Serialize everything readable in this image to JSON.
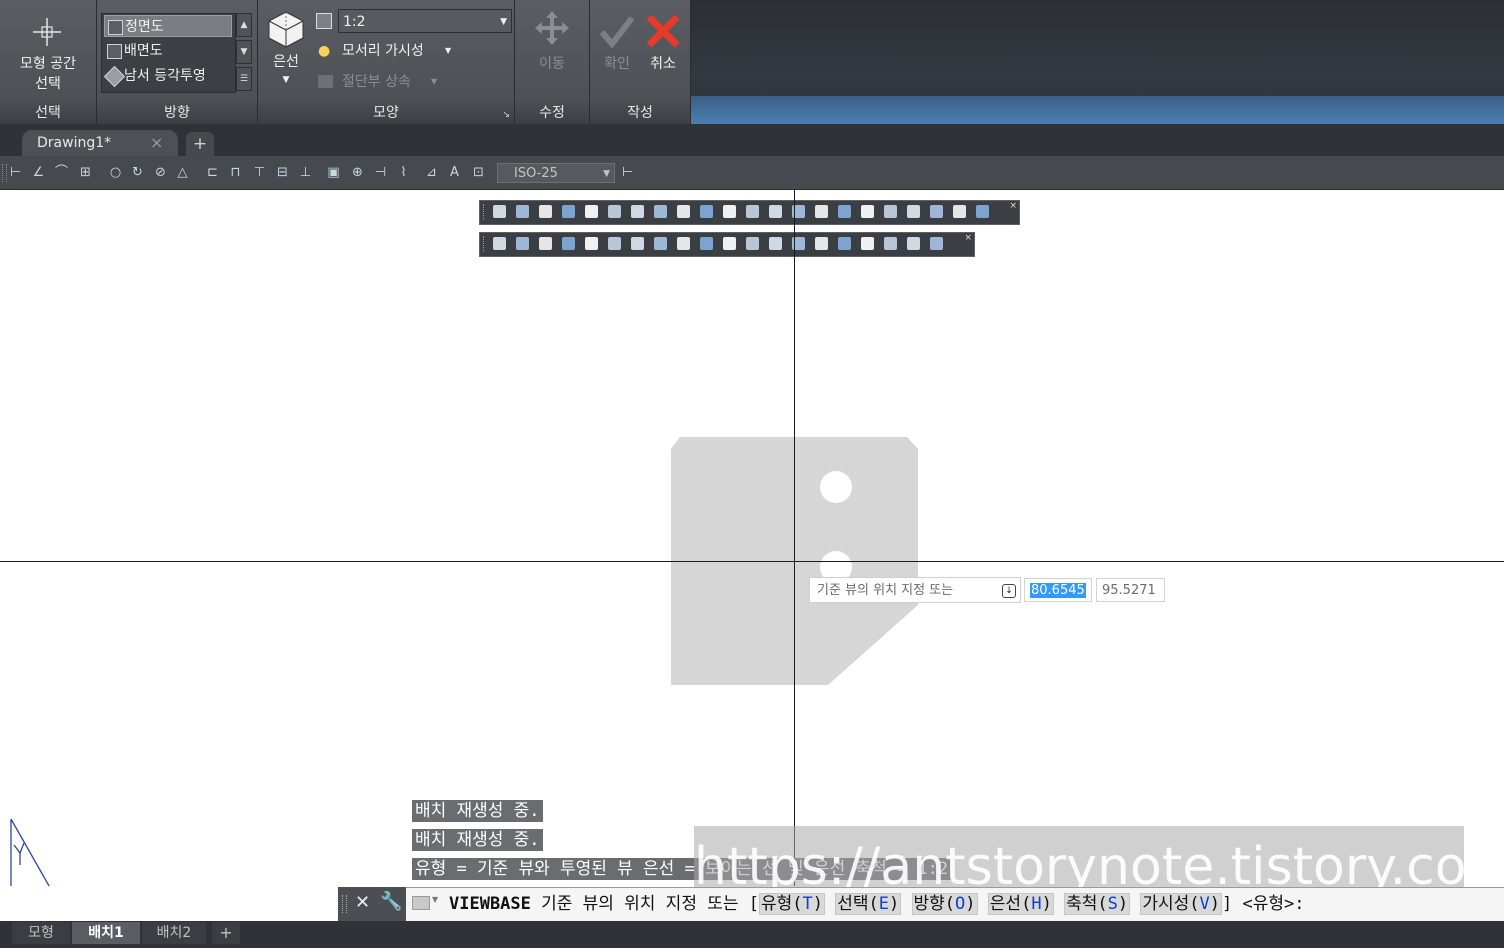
{
  "ribbon": {
    "select_panel": {
      "button_line1": "모형 공간",
      "button_line2": "선택",
      "title": "선택"
    },
    "direction_panel": {
      "views": [
        "정면도",
        "배면도",
        "남서 등각투영"
      ],
      "selected_view": "정면도",
      "title": "방향"
    },
    "shape_panel": {
      "hidden_label": "은선",
      "scale_value": "1:2",
      "edge_visibility": "모서리 가시성",
      "section_inherit": "절단부 상속",
      "title": "모양"
    },
    "modify_panel": {
      "move_label": "이동",
      "title": "수정"
    },
    "create_panel": {
      "ok_label": "확인",
      "cancel_label": "취소",
      "title": "작성"
    }
  },
  "tabs": {
    "active": "Drawing1*",
    "close_glyph": "×",
    "add_glyph": "+"
  },
  "toolbar": {
    "dimstyle": "ISO-25"
  },
  "canvas": {
    "tooltip": "기준 뷰의 위치 지정 또는",
    "coord_x": "80.6545",
    "coord_y": "95.5271"
  },
  "command_history": [
    "배치 재생성 중.",
    "배치 재생성 중.",
    "유형 = 기준 뷰와 투영된 뷰  은선 = 보이는 선 및 은선  축척 = 1:2"
  ],
  "command_line": {
    "command": "VIEWBASE",
    "prompt": "기준 뷰의 위치 지정 또는 [",
    "options": [
      {
        "label": "유형",
        "key": "T"
      },
      {
        "label": "선택",
        "key": "E"
      },
      {
        "label": "방향",
        "key": "O"
      },
      {
        "label": "은선",
        "key": "H"
      },
      {
        "label": "축척",
        "key": "S"
      },
      {
        "label": "가시성",
        "key": "V"
      }
    ],
    "suffix": "] <유형>:"
  },
  "layout_tabs": [
    "모형",
    "배치1",
    "배치2"
  ],
  "active_layout": "배치1",
  "watermark": "https://antstorynote.tistory.com",
  "colors": {
    "selection": "#3399ff",
    "option_key": "#0b3ed6",
    "cancel": "#e8392b",
    "ribbon_accent": "#4b7fb0"
  }
}
